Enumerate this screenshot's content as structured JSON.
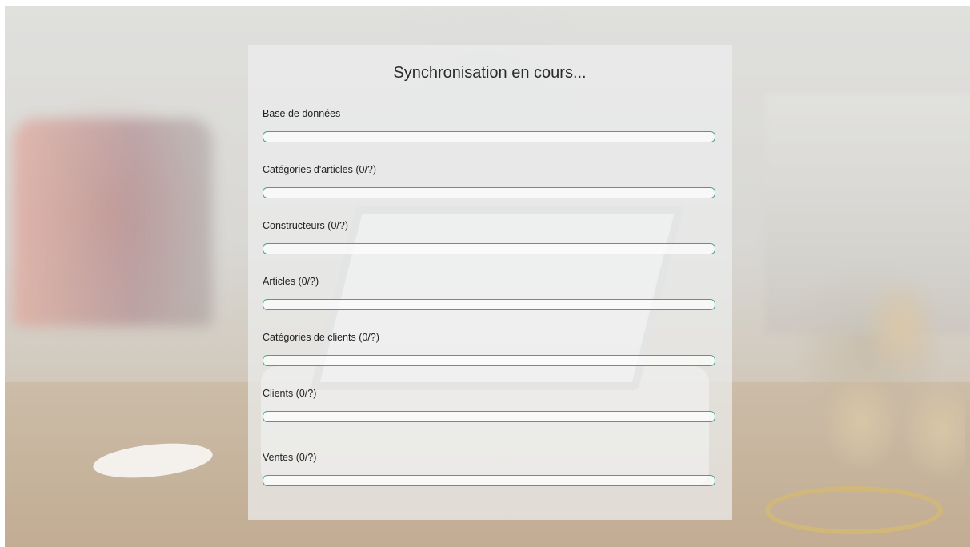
{
  "title": "Synchronisation en cours...",
  "accent_color": "#3aa594",
  "tasks": [
    {
      "label": "Base de données",
      "progress": 0
    },
    {
      "label": "Catégories d'articles (0/?)",
      "progress": 0
    },
    {
      "label": "Constructeurs (0/?)",
      "progress": 0
    },
    {
      "label": "Articles (0/?)",
      "progress": 0
    },
    {
      "label": "Catégories de clients (0/?)",
      "progress": 0
    },
    {
      "label": "Clients (0/?)",
      "progress": 0
    },
    {
      "label": "Ventes (0/?)",
      "progress": 0
    }
  ]
}
